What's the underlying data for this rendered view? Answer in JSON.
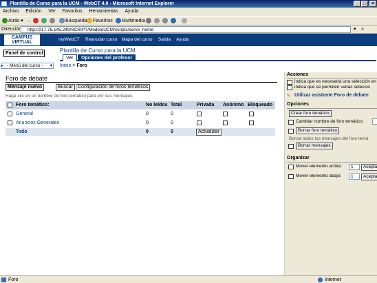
{
  "window": {
    "title": "Plantilla de Curso para la UCM - WebCT 4.0 - Microsoft Internet Explorer",
    "btn_min": "_",
    "btn_max": "□",
    "btn_close": "×"
  },
  "menubar": [
    "Archivo",
    "Edición",
    "Ver",
    "Favoritos",
    "Herramientas",
    "Ayuda"
  ],
  "toolbar": {
    "back": "Atrás",
    "search": "Búsqueda",
    "favorites": "Favoritos",
    "multimedia": "Multimedia"
  },
  "address": {
    "label": "Dirección",
    "url": "http://217.76.145.249/SCRIPT/ModeloUCM/scripts/serve_home",
    "links": "»"
  },
  "header": {
    "logo": "CAMPUS VIRTUAL",
    "nav": [
      "myWebCT",
      "Reanudar curso",
      "Mapa del curso",
      "Salida",
      "Ayuda"
    ]
  },
  "panel_button": "Panel de control",
  "course_title": "Plantilla de Curso para la UCM",
  "tabs": {
    "ver": "Ver",
    "options": "Opciones del profesor"
  },
  "course_menu": "- Menú del curso -",
  "breadcrumb": {
    "home": "Inicio",
    "sep": ">",
    "current": "Foro"
  },
  "main": {
    "title": "Foro de debate",
    "btn_new": "Mensaje nuevo",
    "btn_search": "Buscar",
    "btn_config": "Configuración de foros temáticos",
    "hint": "Haga clic en un nombre de foro temático para ver sus mensajes."
  },
  "table": {
    "headers": [
      "Foro temático:",
      "No leídos",
      "Total",
      "Privada",
      "Anónimo",
      "Bloqueado"
    ],
    "rows": [
      {
        "name": "General",
        "unread": "0",
        "total": "0"
      },
      {
        "name": "Anuncios Generales",
        "unread": "0",
        "total": "0"
      }
    ],
    "footer": {
      "name": "Todo",
      "unread": "0",
      "total": "0",
      "update": "Actualizar"
    }
  },
  "right": {
    "actions_title": "Acciones",
    "legend_sel": "indica que es necesaria una selección en",
    "legend_multi": "indica que se permiten varias seleccio",
    "wizard": "Utilizar asistente Foro de debate",
    "options_title": "Opciones",
    "create": "Crear foro temático",
    "rename": "Cambiar nombre de foro temático:",
    "delete_forum": "Borrar foro temático",
    "delete_all_hint": "Borrar todos los mensajes del foro temá",
    "delete_msgs": "Borrar mensajes",
    "organize_title": "Organizar",
    "move_up": "Mover elemento arriba:",
    "move_down": "Mover elemento abajo:",
    "sel_value": "1",
    "accept": "Aceptar"
  },
  "status": {
    "left": "Foro",
    "zone": "Internet"
  }
}
